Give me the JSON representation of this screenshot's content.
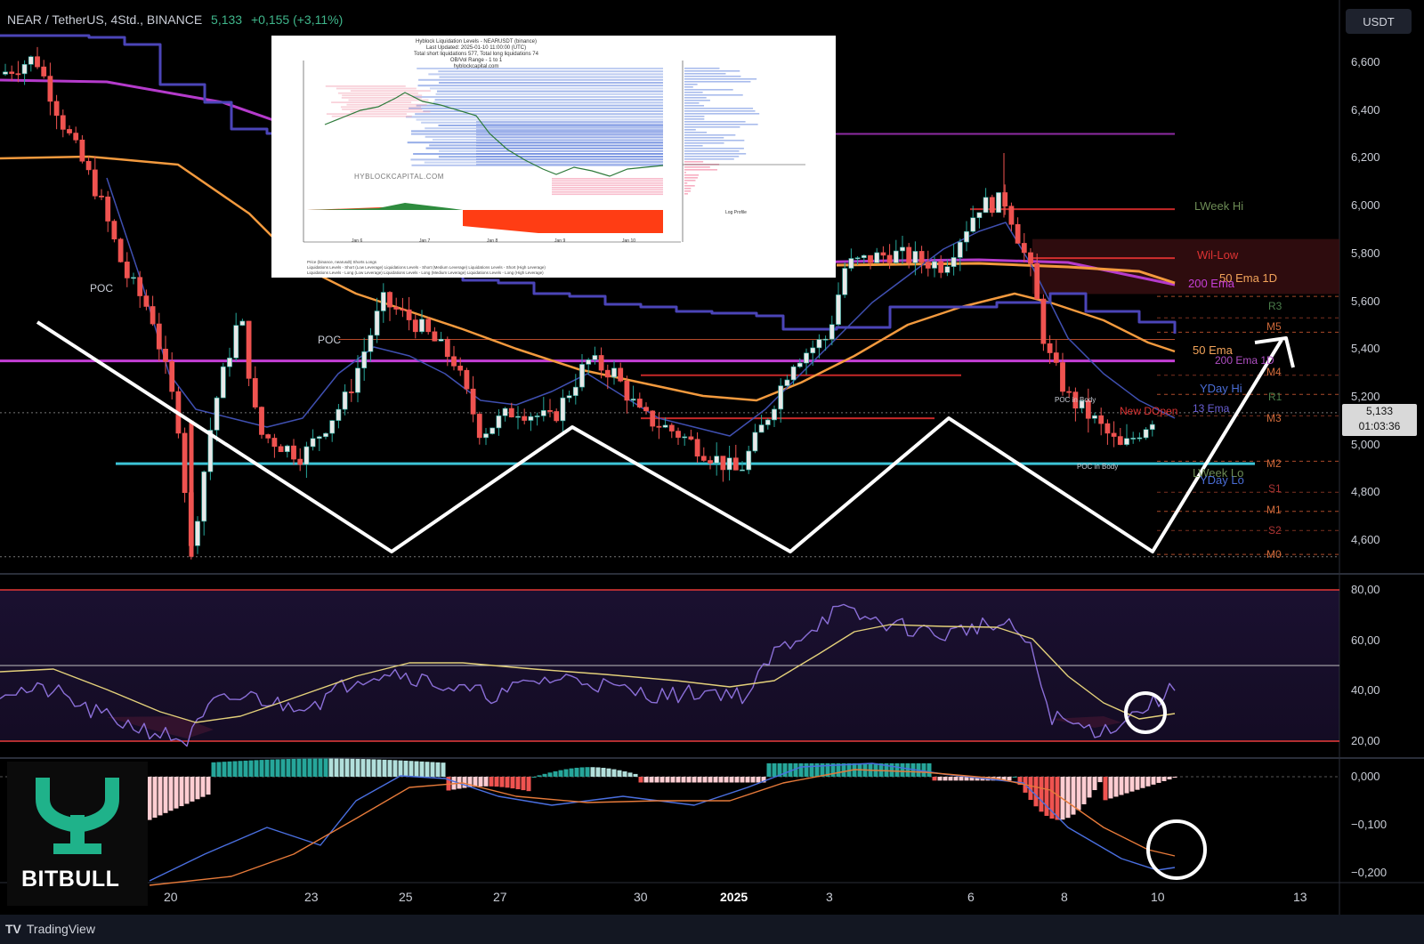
{
  "header": {
    "symbol": "NEAR / TetherUS, 4Std., BINANCE",
    "last": "5,133",
    "change": "+0,155 (+3,11%)"
  },
  "currency_button": "USDT",
  "price_axis": [
    "6,600",
    "6,400",
    "6,200",
    "6,000",
    "5,800",
    "5,600",
    "5,400",
    "5,200",
    "5,000",
    "4,800",
    "4,600"
  ],
  "current_price_tag": {
    "price": "5,133",
    "countdown": "01:03:36"
  },
  "rsi_axis": [
    "80,00",
    "60,00",
    "40,00",
    "20,00"
  ],
  "macd_axis": [
    "0,000",
    "−0,100",
    "−0,200"
  ],
  "date_axis": [
    {
      "label": "20",
      "bold": false
    },
    {
      "label": "23",
      "bold": false
    },
    {
      "label": "25",
      "bold": false
    },
    {
      "label": "27",
      "bold": false
    },
    {
      "label": "30",
      "bold": false
    },
    {
      "label": "2025",
      "bold": true
    },
    {
      "label": "3",
      "bold": false
    },
    {
      "label": "6",
      "bold": false
    },
    {
      "label": "8",
      "bold": false
    },
    {
      "label": "10",
      "bold": false
    },
    {
      "label": "13",
      "bold": false
    }
  ],
  "level_labels": {
    "lweek_hi": "LWeek Hi",
    "wil_low": "Wil-Low",
    "ema50_1d": "50 Ema 1D",
    "ema200": "200 Ema",
    "r3": "R3",
    "m5": "M5",
    "ema50": "50 Ema",
    "ema200_1d": "200 Ema 1D",
    "m4": "M4",
    "yday_hi": "YDay Hi",
    "r1": "R1",
    "m3": "M3",
    "new_dopen": "New DOpen",
    "ema13": "13 Ema",
    "m2": "M2",
    "lweek_lo": "LWeek Lo",
    "yday_lo": "YDay Lo",
    "s1": "S1",
    "m1": "M1",
    "s2": "S2",
    "m0": "M0",
    "poc1": "POC",
    "poc2": "POC",
    "poc_in_body_1": "POC in Body",
    "poc_in_body_2": "POC in Body"
  },
  "colors": {
    "bull": "#26a69a",
    "bear": "#ef5350",
    "ema_orange": "#f39a3e",
    "ema_purple": "#c43fd6",
    "ichimoku": "#4b45b8",
    "cyan_support": "#3cc3d6",
    "rsi_line": "#8b6fd8",
    "rsi_ma": "#e3d07a"
  },
  "inset": {
    "title": "Hyblock Liquidation Levels - NEARUSDT (binance)",
    "updated": "Last Updated: 2025-01-10 11:00:00 (UTC)",
    "totals": "Total short liquidations 577, Total long liquidations 74",
    "range": "OB/Vol Range - 1 to 1",
    "site": "hyblockcapital.com",
    "watermark": "HYBLOCKCAPITAL.COM",
    "log_profile": "Log Profile",
    "x_dates": [
      "Jan 6",
      "Jan 7",
      "Jan 8",
      "Jan 9",
      "Jan 10"
    ],
    "legend_1": "Price (binance, nearusdt)      Shorts                                   Longs",
    "legend_2": "Liquidations Levels - Short (Low Leverage)    Liquidations Levels - Short (Medium Leverage)    Liquidations Levels - Short (High Leverage)",
    "legend_3": "Liquidations Levels - Long (Low Leverage)     Liquidations Levels - Long (Medium Leverage)     Liquidations Levels - Long (High Leverage)"
  },
  "brand": {
    "name": "BITBULL"
  },
  "footer": {
    "name": "TradingView"
  }
}
